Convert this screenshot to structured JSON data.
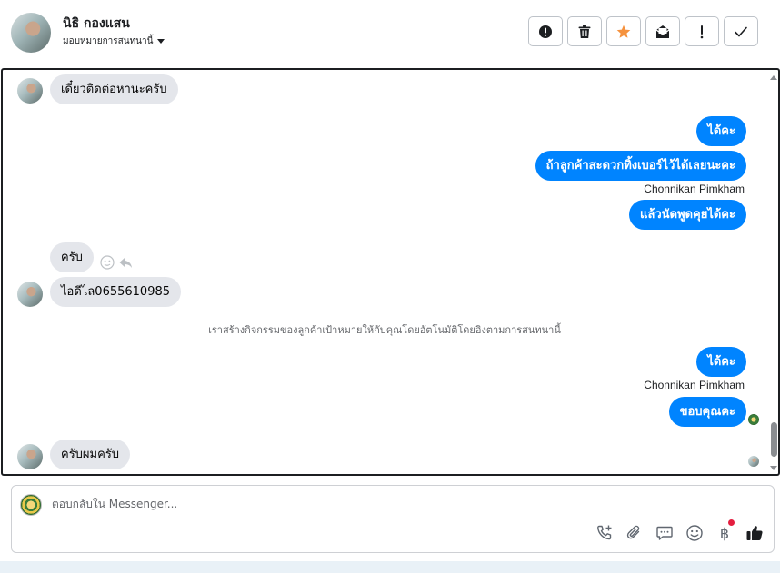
{
  "header": {
    "contact_name": "นิธิ กองแสน",
    "assign_label": "มอบหมายการสนทนานี้",
    "tools": [
      {
        "name": "spam-icon"
      },
      {
        "name": "trash-icon"
      },
      {
        "name": "star-icon"
      },
      {
        "name": "mark-unread-icon"
      },
      {
        "name": "follow-up-icon"
      },
      {
        "name": "done-check-icon"
      }
    ]
  },
  "messages": [
    {
      "id": "m1",
      "direction": "in",
      "text": "เดี๋ยวติดต่อหานะครับ"
    },
    {
      "id": "m2",
      "direction": "out",
      "text": "ได้คะ"
    },
    {
      "id": "m3",
      "direction": "out",
      "text": "ถ้าลูกค้าสะดวกทิ้งเบอร์ไว้ได้เลยนะคะ"
    },
    {
      "id": "m4",
      "direction": "out",
      "sender": "Chonnikan Pimkham",
      "text": "แล้วนัดพูดคุยได้คะ"
    },
    {
      "id": "m5",
      "direction": "in",
      "text": "ครับ"
    },
    {
      "id": "m6",
      "direction": "in",
      "text": "ไอดีไล0655610985"
    },
    {
      "id": "m7",
      "direction": "system",
      "text": "เราสร้างกิจกรรมของลูกค้าเป้าหมายให้กับคุณโดยอัตโนมัติโดยอิงตามการสนทนานี้"
    },
    {
      "id": "m8",
      "direction": "out",
      "text": "ได้คะ"
    },
    {
      "id": "m9",
      "direction": "out",
      "sender": "Chonnikan Pimkham",
      "text": "ขอบคุณคะ"
    },
    {
      "id": "m10",
      "direction": "in",
      "text": "ครับผมครับ"
    }
  ],
  "composer": {
    "placeholder": "ตอบกลับใน Messenger...",
    "tools": [
      "call-add-icon",
      "attachment-icon",
      "saved-reply-icon",
      "emoji-icon",
      "payment-baht-icon",
      "like-icon"
    ],
    "payment_symbol": "฿"
  },
  "colors": {
    "outgoing_bubble": "#0084ff",
    "incoming_bubble": "#e4e6eb",
    "star_accent": "#f5923e",
    "notification_dot": "#e41e3f"
  }
}
